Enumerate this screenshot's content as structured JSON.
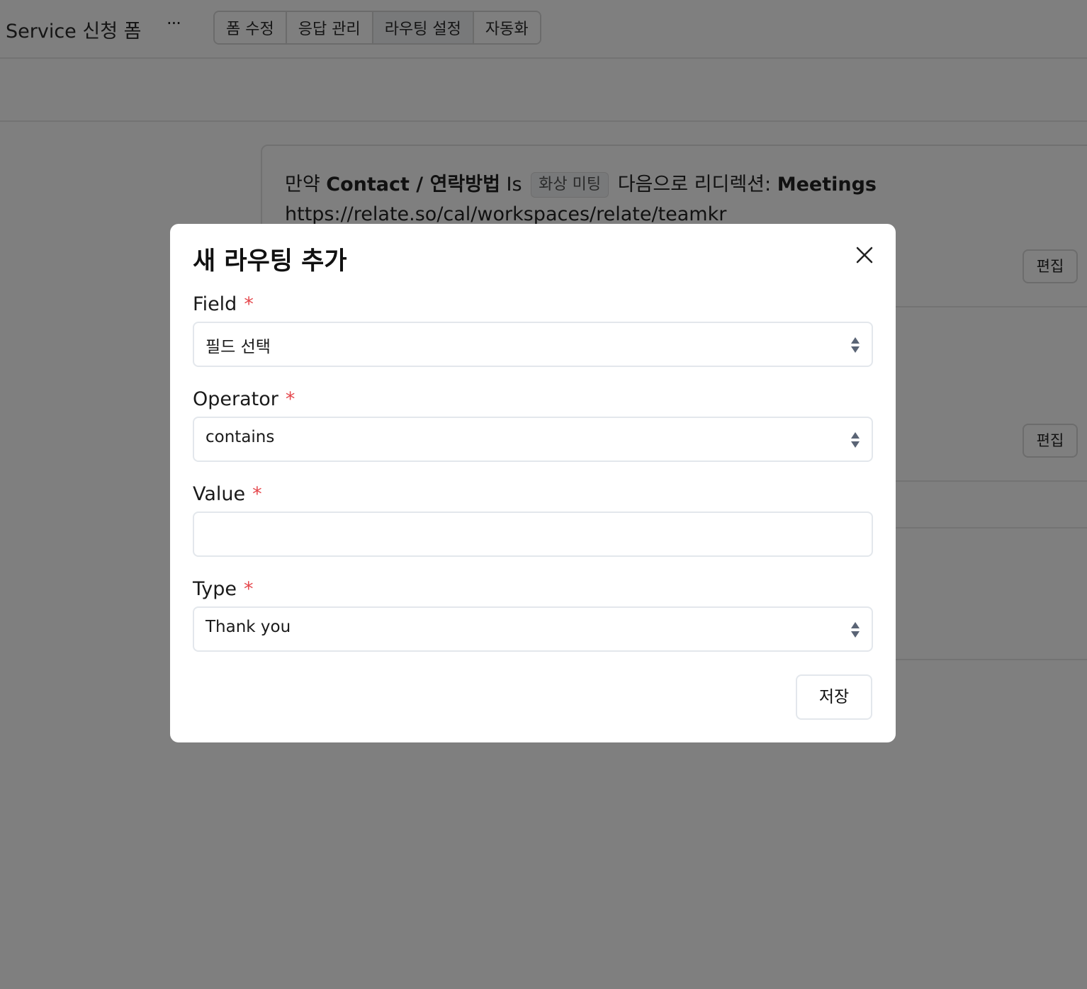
{
  "app": {
    "title": "Service 신청 폼",
    "more": "···"
  },
  "tabs": [
    {
      "label": "폼 수정"
    },
    {
      "label": "응답 관리"
    },
    {
      "label": "라우팅 설정"
    },
    {
      "label": "자동화"
    }
  ],
  "rule": {
    "prefix": "만약",
    "field": "Contact / 연락방법",
    "operator": "Is",
    "value": "화상 미팅",
    "redirect_text": "다음으로 리디렉션:",
    "target": "Meetings",
    "url": "https://relate.so/cal/workspaces/relate/teamkr"
  },
  "edit_buttons": [
    "편집",
    "편집"
  ],
  "modal": {
    "title": "새 라우팅 추가",
    "close_icon": "close-icon",
    "required_mark": "*",
    "fields": {
      "field": {
        "label": "Field",
        "selected": "필드 선택"
      },
      "operator": {
        "label": "Operator",
        "selected": "contains"
      },
      "value": {
        "label": "Value",
        "value": ""
      },
      "type": {
        "label": "Type",
        "selected": "Thank you"
      }
    },
    "save_label": "저장"
  },
  "colors": {
    "required": "#e5484d",
    "overlay": "rgba(0,0,0,0.5)",
    "select_arrow": "#5a6475"
  }
}
